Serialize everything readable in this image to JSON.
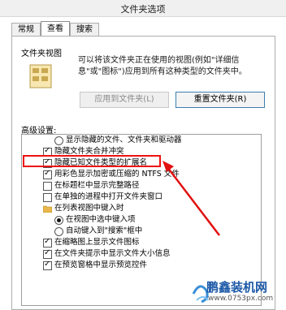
{
  "window": {
    "title": "文件夹选项"
  },
  "tabs": [
    {
      "label": "常规"
    },
    {
      "label": "查看"
    },
    {
      "label": "搜索"
    }
  ],
  "folder_views": {
    "title": "文件夹视图",
    "description": "可以将该文件夹正在使用的视图(例如\"详细信息\"或\"图标\")应用到所有这种类型的文件夹中。",
    "apply_button": "应用到文件夹(L)",
    "reset_button": "重置文件夹(R)"
  },
  "advanced": {
    "title": "高级设置:",
    "items": [
      {
        "type": "radio",
        "checked": false,
        "label": "显示隐藏的文件、文件夹和驱动器"
      },
      {
        "type": "checkbox",
        "checked": true,
        "label": "隐藏文件夹合并冲突"
      },
      {
        "type": "checkbox",
        "checked": true,
        "label": "隐藏已知文件类型的扩展名"
      },
      {
        "type": "checkbox",
        "checked": true,
        "label": "用彩色显示加密或压缩的 NTFS 文件"
      },
      {
        "type": "checkbox",
        "checked": false,
        "label": "在标题栏中显示完整路径"
      },
      {
        "type": "checkbox",
        "checked": false,
        "label": "在单独的进程中打开文件夹窗口"
      },
      {
        "type": "folder",
        "label": "在列表视图中键入时"
      },
      {
        "type": "radio",
        "checked": true,
        "label": "在视图中选中键入项"
      },
      {
        "type": "radio",
        "checked": false,
        "label": "自动键入到\"搜索\"框中"
      },
      {
        "type": "checkbox",
        "checked": true,
        "label": "在缩略图上显示文件图标"
      },
      {
        "type": "checkbox",
        "checked": true,
        "label": "在文件夹提示中显示文件大小信息"
      },
      {
        "type": "checkbox",
        "checked": true,
        "label": "在预览窗格中显示预览控件"
      }
    ]
  },
  "watermark": {
    "name": "鹏鑫装机网",
    "url": "www.0753px.com"
  },
  "colors": {
    "highlight": "#e11111",
    "watermark": "#1d5aa8"
  }
}
